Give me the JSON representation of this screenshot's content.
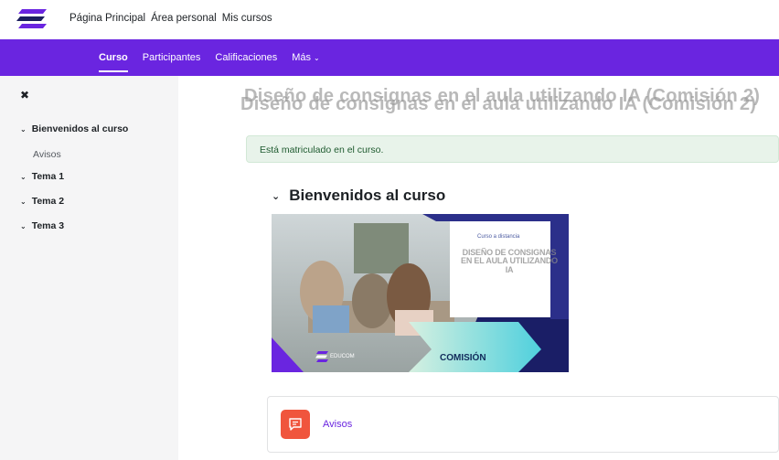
{
  "topnav": {
    "items": [
      "Página Principal",
      "Área personal",
      "Mis cursos"
    ]
  },
  "coursenav": {
    "tabs": [
      {
        "label": "Curso",
        "active": true
      },
      {
        "label": "Participantes",
        "active": false
      },
      {
        "label": "Calificaciones",
        "active": false
      },
      {
        "label": "Más",
        "active": false
      }
    ],
    "more_chevron": "⌄"
  },
  "drawer": {
    "close_icon": "✖",
    "sections": [
      {
        "label": "Bienvenidos al curso",
        "items": [
          "Avisos"
        ]
      },
      {
        "label": "Tema 1",
        "items": []
      },
      {
        "label": "Tema 2",
        "items": []
      },
      {
        "label": "Tema 3",
        "items": []
      }
    ]
  },
  "main": {
    "course_title": "Diseño de consignas en el aula utilizando IA (Comisión 2)",
    "alert": "Está matriculado en el curso.",
    "section_title": "Bienvenidos al curso",
    "banner": {
      "subtitle": "Curso a distancia",
      "blurred_title": "DISEÑO DE CONSIGNAS EN EL AULA UTILIZANDO IA",
      "comision": "COMISIÓN",
      "brand": "EDUCOM"
    },
    "activity": {
      "label": "Avisos",
      "icon": "forum-icon"
    }
  },
  "colors": {
    "brand_purple": "#6a25e0",
    "alert_bg": "#e8f3ea",
    "forum_icon": "#f0553d"
  }
}
